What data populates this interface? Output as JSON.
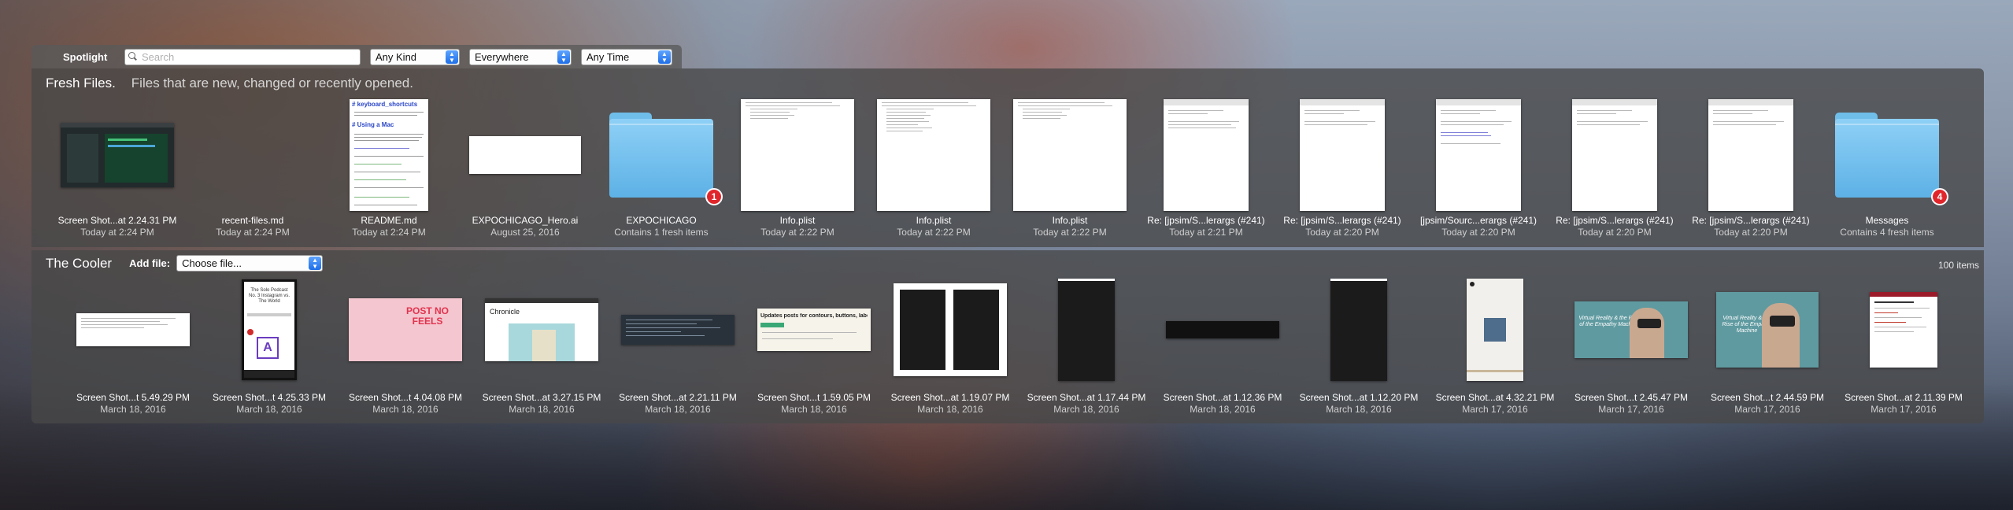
{
  "spotlight": {
    "label": "Spotlight",
    "search_placeholder": "Search",
    "kind": "Any Kind",
    "location": "Everywhere",
    "time": "Any Time"
  },
  "fresh": {
    "title": "Fresh Files.",
    "subtitle": "Files that are new, changed or recently opened.",
    "items": [
      {
        "name": "Screen Shot...at 2.24.31 PM",
        "date": "Today at 2:24 PM"
      },
      {
        "name": "recent-files.md",
        "date": "Today at 2:24 PM"
      },
      {
        "name": "README.md",
        "date": "Today at 2:24 PM"
      },
      {
        "name": "EXPOCHICAGO_Hero.ai",
        "date": "August 25, 2016"
      },
      {
        "name": "EXPOCHICAGO",
        "date": "Contains 1 fresh items",
        "badge": "1"
      },
      {
        "name": "Info.plist",
        "date": "Today at 2:22 PM"
      },
      {
        "name": "Info.plist",
        "date": "Today at 2:22 PM"
      },
      {
        "name": "Info.plist",
        "date": "Today at 2:22 PM"
      },
      {
        "name": "Re: [jpsim/S...lerargs (#241)",
        "date": "Today at 2:21 PM"
      },
      {
        "name": "Re: [jpsim/S...lerargs (#241)",
        "date": "Today at 2:20 PM"
      },
      {
        "name": "[jpsim/Sourc...erargs (#241)",
        "date": "Today at 2:20 PM"
      },
      {
        "name": "Re: [jpsim/S...lerargs (#241)",
        "date": "Today at 2:20 PM"
      },
      {
        "name": "Re: [jpsim/S...lerargs (#241)",
        "date": "Today at 2:20 PM"
      },
      {
        "name": "Messages",
        "date": "Contains 4 fresh items",
        "badge": "4"
      }
    ],
    "readme_heading": "# keyboard_shortcuts",
    "readme_sub": "# Using a Mac"
  },
  "cooler": {
    "title": "The Cooler",
    "add_file_label": "Add file:",
    "choose_file": "Choose file...",
    "count": "100 items",
    "items": [
      {
        "name": "Screen Shot...t 5.49.29 PM",
        "date": "March 18, 2016"
      },
      {
        "name": "Screen Shot...t 4.25.33 PM",
        "date": "March 18, 2016"
      },
      {
        "name": "Screen Shot...t 4.04.08 PM",
        "date": "March 18, 2016"
      },
      {
        "name": "Screen Shot...at 3.27.15 PM",
        "date": "March 18, 2016"
      },
      {
        "name": "Screen Shot...at 2.21.11 PM",
        "date": "March 18, 2016"
      },
      {
        "name": "Screen Shot...t 1.59.05 PM",
        "date": "March 18, 2016"
      },
      {
        "name": "Screen Shot...at 1.19.07 PM",
        "date": "March 18, 2016"
      },
      {
        "name": "Screen Shot...at 1.17.44 PM",
        "date": "March 18, 2016"
      },
      {
        "name": "Screen Shot...at 1.12.36 PM",
        "date": "March 18, 2016"
      },
      {
        "name": "Screen Shot...at 1.12.20 PM",
        "date": "March 18, 2016"
      },
      {
        "name": "Screen Shot...at 4.32.21 PM",
        "date": "March 17, 2016"
      },
      {
        "name": "Screen Shot...t 2.45.47 PM",
        "date": "March 17, 2016"
      },
      {
        "name": "Screen Shot...t 2.44.59 PM",
        "date": "March 17, 2016"
      },
      {
        "name": "Screen Shot...at 2.11.39 PM",
        "date": "March 17, 2016"
      }
    ],
    "thumb_text": {
      "podcast": "The Solo Podcast No. 3 Instagram vs. The World",
      "podcast_letter": "A",
      "post_no_feels": "POST NO FEELS",
      "chronicle": "Chronicle",
      "updates": "Updates posts for contours, buttons, labels",
      "virtual": "Virtual Reality & the Rise of the Empathy Machine"
    }
  }
}
